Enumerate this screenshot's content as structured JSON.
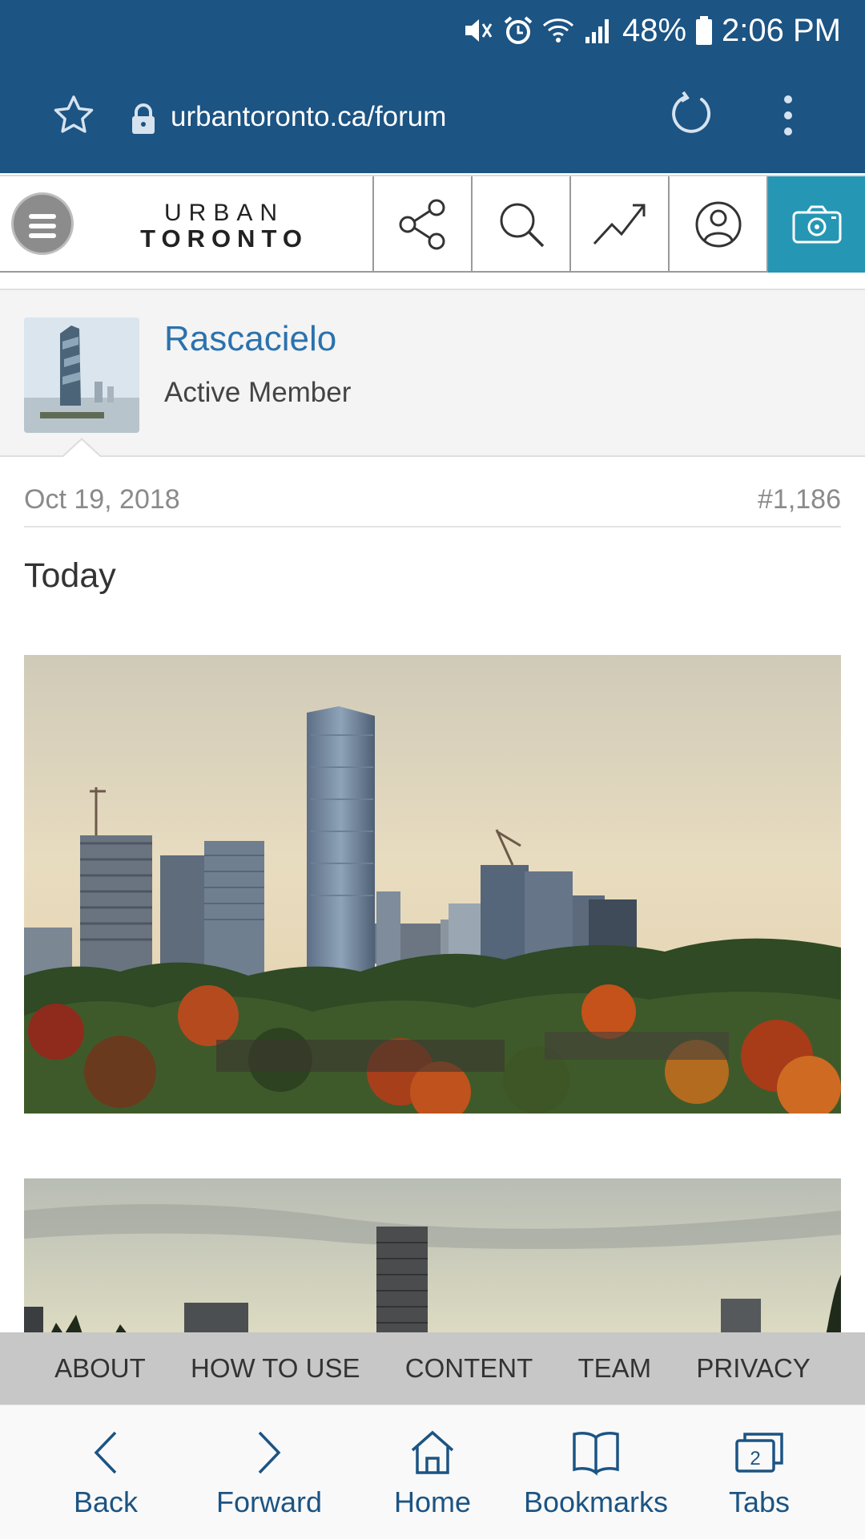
{
  "status_bar": {
    "battery": "48%",
    "time": "2:06 PM",
    "icons": [
      "mute-icon",
      "alarm-icon",
      "wifi-icon",
      "signal-icon",
      "battery-icon"
    ]
  },
  "browser": {
    "url": "urbantoronto.ca/forum",
    "icons": [
      "star-icon",
      "lock-icon",
      "reload-icon",
      "more-icon"
    ]
  },
  "site_header": {
    "logo_top": "URBAN",
    "logo_bottom": "TORONTO",
    "buttons": [
      "menu-icon",
      "share-icon",
      "search-icon",
      "trending-icon",
      "user-icon",
      "camera-icon"
    ],
    "accent": "#2696b5"
  },
  "post": {
    "username": "Rascacielo",
    "user_title": "Active Member",
    "date": "Oct 19, 2018",
    "number": "#1,186",
    "text": "Today"
  },
  "footer_links": [
    "ABOUT",
    "HOW TO USE",
    "CONTENT",
    "TEAM",
    "PRIVACY"
  ],
  "bottom_nav": [
    {
      "label": "Back",
      "icon": "chevron-left-icon"
    },
    {
      "label": "Forward",
      "icon": "chevron-right-icon"
    },
    {
      "label": "Home",
      "icon": "home-icon"
    },
    {
      "label": "Bookmarks",
      "icon": "book-icon"
    },
    {
      "label": "Tabs",
      "icon": "tabs-icon",
      "count": "2"
    }
  ],
  "colors": {
    "browser_bar": "#1c5483",
    "username_link": "#2b72ad",
    "nav_text": "#1c5483"
  }
}
